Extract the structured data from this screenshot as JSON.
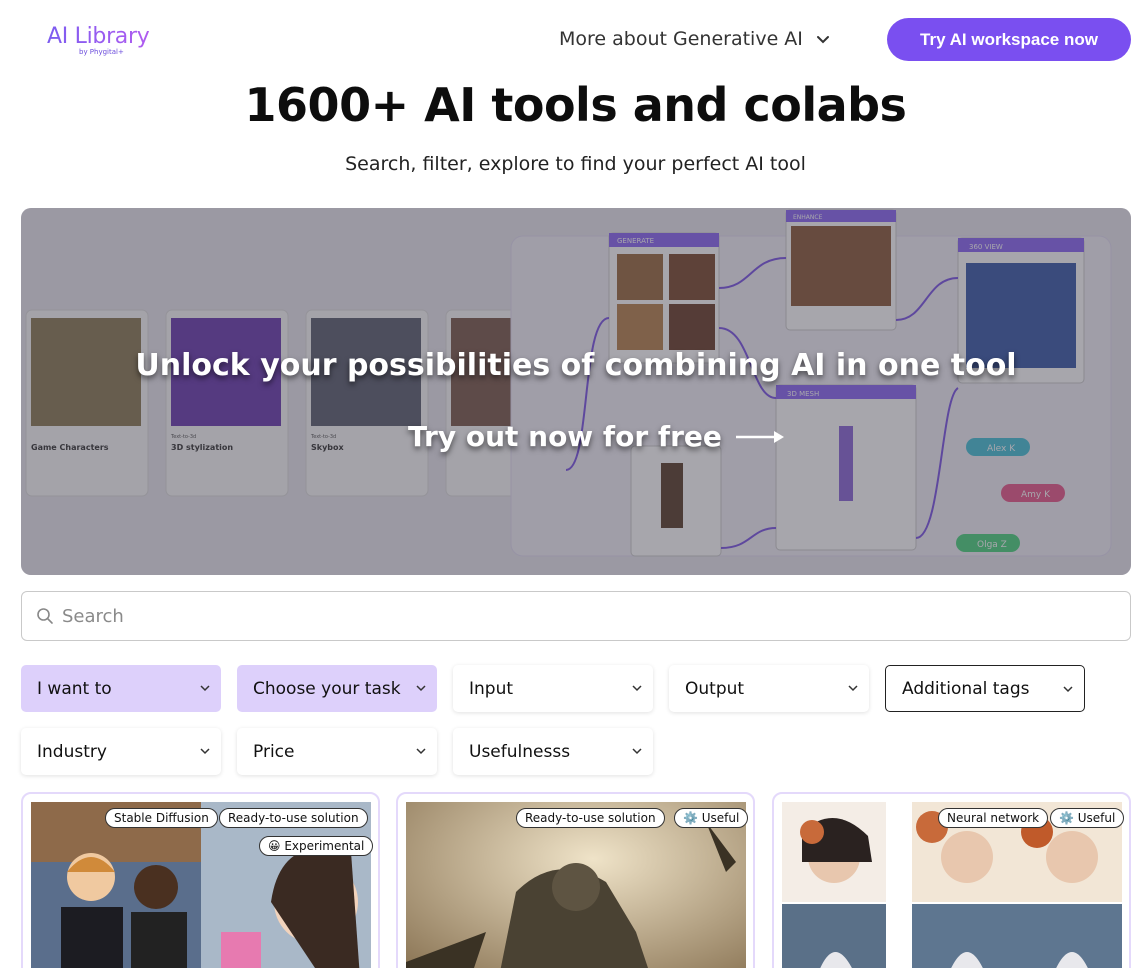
{
  "header": {
    "logo_text": "AI Library",
    "logo_sub": "by Phygital+",
    "nav_more": "More about Generative AI",
    "cta": "Try AI workspace now"
  },
  "hero": {
    "title": "1600+ AI tools and colabs",
    "subtitle": "Search, filter, explore to find your perfect AI tool"
  },
  "banner": {
    "headline": "Unlock your possibilities of combining AI in one tool",
    "cta": "Try out now for free",
    "cta_icon": "arrow-right-icon",
    "node_labels": [
      "GENERATE",
      "ENHANCE",
      "360 VIEW",
      "3D MESH"
    ],
    "card_titles": [
      "Game Characters",
      "3D stylization",
      "Skybox"
    ],
    "card_kickers": [
      "Text-to-3d",
      "Text-to-3d"
    ],
    "users": [
      "Alex K",
      "Amy K",
      "Olga Z"
    ]
  },
  "search": {
    "placeholder": "Search",
    "value": ""
  },
  "filters": [
    {
      "label": "I want to",
      "style": "purple"
    },
    {
      "label": "Choose your task",
      "style": "purple"
    },
    {
      "label": "Input",
      "style": "plain"
    },
    {
      "label": "Output",
      "style": "plain"
    },
    {
      "label": "Additional tags",
      "style": "outlined"
    },
    {
      "label": "Industry",
      "style": "plain"
    },
    {
      "label": "Price",
      "style": "plain"
    },
    {
      "label": "Usefulnesss",
      "style": "plain"
    }
  ],
  "cards": [
    {
      "tags": [
        "Stable Diffusion",
        "Ready-to-use solution",
        "😀 Experimental"
      ]
    },
    {
      "tags": [
        "Ready-to-use solution",
        "⚙️ Useful"
      ]
    },
    {
      "tags": [
        "Neural network",
        "⚙️ Useful"
      ]
    }
  ],
  "colors": {
    "accent": "#7a4ff0",
    "filter_purple": "#ddd0fb",
    "card_border": "#e4d9fb"
  }
}
